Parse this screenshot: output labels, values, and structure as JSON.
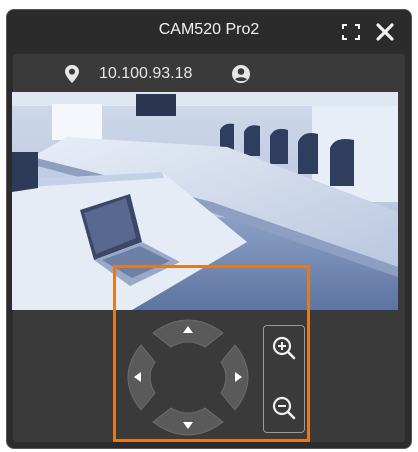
{
  "window": {
    "title": "CAM520 Pro2"
  },
  "info": {
    "ip_address": "10.100.93.18"
  },
  "icons": {
    "ip": "location-pin-icon",
    "user": "user-circle-icon",
    "fullscreen": "fullscreen-icon",
    "close": "close-icon",
    "zoom_in": "zoom-in-icon",
    "zoom_out": "zoom-out-icon"
  },
  "colors": {
    "window_bg": "#2b2b2b",
    "panel_bg": "#3a3a3a",
    "highlight": "#e07b21",
    "control": "#5a5a5a",
    "video_tint": "#6f86b3"
  }
}
